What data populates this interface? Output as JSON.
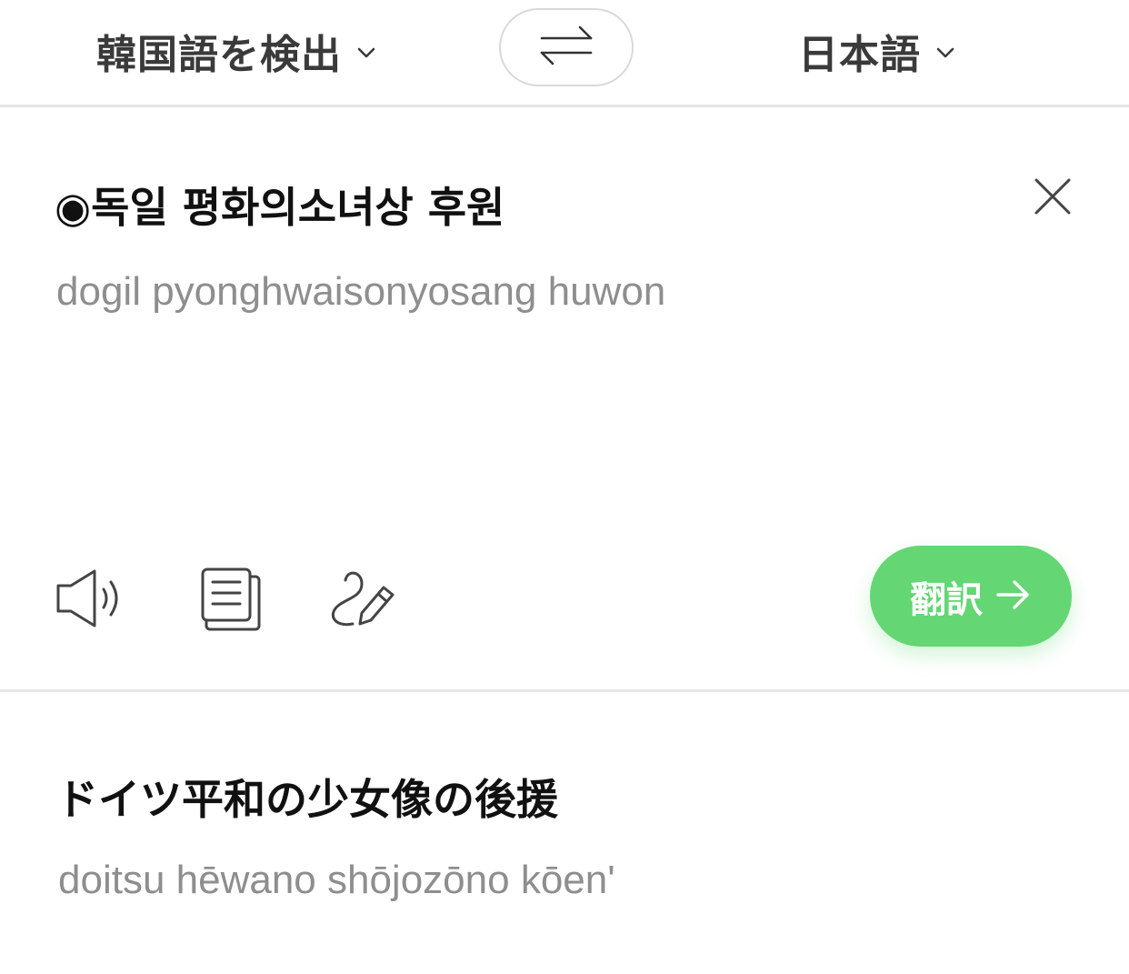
{
  "language_bar": {
    "source_language": "韓国語を検出",
    "target_language": "日本語",
    "swap_icon": "swap-arrows-icon",
    "dropdown_icon": "chevron-down-icon"
  },
  "input": {
    "text": "◉독일 평화의소녀상 후원",
    "romanization": "dogil pyonghwaisonyosang huwon",
    "clear_icon": "close-icon",
    "tools": [
      {
        "name": "speaker",
        "icon": "speaker-icon"
      },
      {
        "name": "copy",
        "icon": "copy-icon"
      },
      {
        "name": "handwriting",
        "icon": "handwriting-pen-icon"
      }
    ],
    "translate_button": {
      "label": "翻訳",
      "icon": "arrow-right-icon",
      "color": "#64d673"
    }
  },
  "output": {
    "text": "ドイツ平和の少女像の後援",
    "romanization": "doitsu hēwano shōjozōno kōen'"
  }
}
